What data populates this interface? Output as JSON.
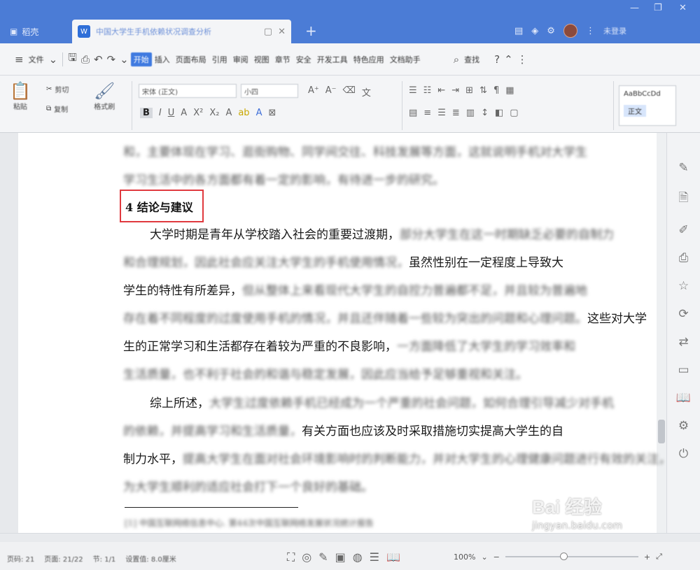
{
  "titlebar": {
    "home_tab": "稻壳",
    "doc_tab_title": "中国大学生手机依赖状况调查分析",
    "doc_icon_label": "W",
    "login_text": "未登录"
  },
  "menubar": {
    "file": "文件",
    "items": [
      "开始",
      "插入",
      "页面布局",
      "引用",
      "审阅",
      "视图",
      "章节",
      "安全",
      "开发工具",
      "特色应用",
      "文档助手"
    ],
    "search": "查找"
  },
  "ribbon": {
    "paste": "粘贴",
    "cut": "剪切",
    "copy": "复制",
    "format_painter": "格式刷",
    "font_name": "宋体 (正文)",
    "font_size": "小四",
    "style_label": "正文",
    "style_preview": "AaBbCcDd"
  },
  "document": {
    "line1": "和，主要体现在学习、逛街购物、同学间交往、科技发展等方面，这就说明手机对大学生",
    "line2": "学习生活中的各方面都有着一定的影响，有待进一步的研究。",
    "heading": "4 结论与建议",
    "p1_visible": "大学时期是青年从学校踏入社会的重要过渡期，",
    "p1_blur_a": "部分大学生在这一时期缺乏必要的自制力",
    "p1_line2_blur": "和合理规划，因此社会应关注大学生的手机使用情况，",
    "p1_line2_visible": "虽然性别在一定程度上导致大",
    "p1_line3_visible": "学生的特性有所差异，",
    "p1_line3_blur": "但从整体上来看现代大学生的自控力普遍都不足，并且较为普遍地",
    "p1_line4_blur": "存在着不同程度的过度使用手机的情况，并且还伴随着一些较为突出的问题和心理问题。",
    "p1_line4_visible": "这些对大学",
    "p1_line5_visible": "生的正常学习和生活都存在着较为严重的不良影响，",
    "p1_line5_blur": "一方面降低了大学生的学习效率和",
    "p1_line6_blur": "生活质量，也不利于社会的和谐与稳定发展，因此应当给予足够重视和关注。",
    "p2_visible": "综上所述，",
    "p2_blur_a": "大学生过度依赖手机已经成为一个严重的社会问题，如何合理引导减少对手机",
    "p2_line2_blur": "的依赖，并提高学习和生活质量，",
    "p2_line2_visible": "有关方面也应该及时采取措施切实提高大学生的自",
    "p2_line3_visible": "制力水平，",
    "p2_line3_blur": "提高大学生在面对社会环境影响时的判断能力，并对大学生的心理健康问题进行有效的关注，",
    "p2_line4_blur": "为大学生顺利的适应社会打下一个良好的基础。",
    "footnote": "[1] 中国互联网络信息中心. 第44次中国互联网络发展状况统计报告"
  },
  "statusbar": {
    "page": "页码: 21",
    "pages": "页面: 21/22",
    "section": "节: 1/1",
    "words": "设置值: 8.0厘米",
    "zoom": "100%"
  },
  "watermark": {
    "brand": "Bai 经验",
    "url": "jingyan.baidu.com"
  }
}
